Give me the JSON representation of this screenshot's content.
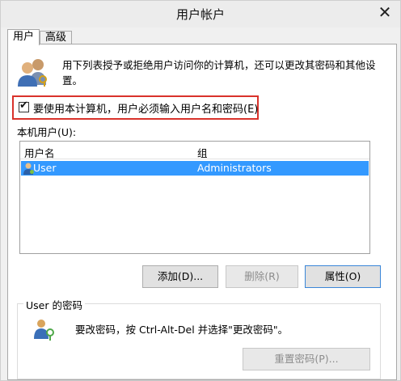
{
  "window": {
    "title": "用户帐户",
    "close_glyph": "✕"
  },
  "tabs": [
    {
      "label": "用户",
      "active": true
    },
    {
      "label": "高级",
      "active": false
    }
  ],
  "intro": {
    "icon": "users-icon",
    "text": "用下列表授予或拒绝用户访问你的计算机，还可以更改其密码和其他设置。"
  },
  "require_login": {
    "checked": true,
    "check_glyph": "✔",
    "label": "要使用本计算机，用户必须输入用户名和密码(E)"
  },
  "users_section": {
    "label": "本机用户(U):",
    "columns": [
      "用户名",
      "组"
    ],
    "rows": [
      {
        "username": "User",
        "group": "Administrators",
        "selected": true,
        "icon": "user-icon"
      }
    ]
  },
  "buttons": {
    "add": "添加(D)...",
    "remove": "删除(R)",
    "properties": "属性(O)"
  },
  "password_group": {
    "title": "User 的密码",
    "icon": "key-icon",
    "text": "要改密码，按 Ctrl-Alt-Del 并选择\"更改密码\"。",
    "reset_button": "重置密码(P)..."
  },
  "colors": {
    "selection": "#3399ff",
    "highlight_box": "#d9322b",
    "window_bg": "#f0f0f0"
  }
}
